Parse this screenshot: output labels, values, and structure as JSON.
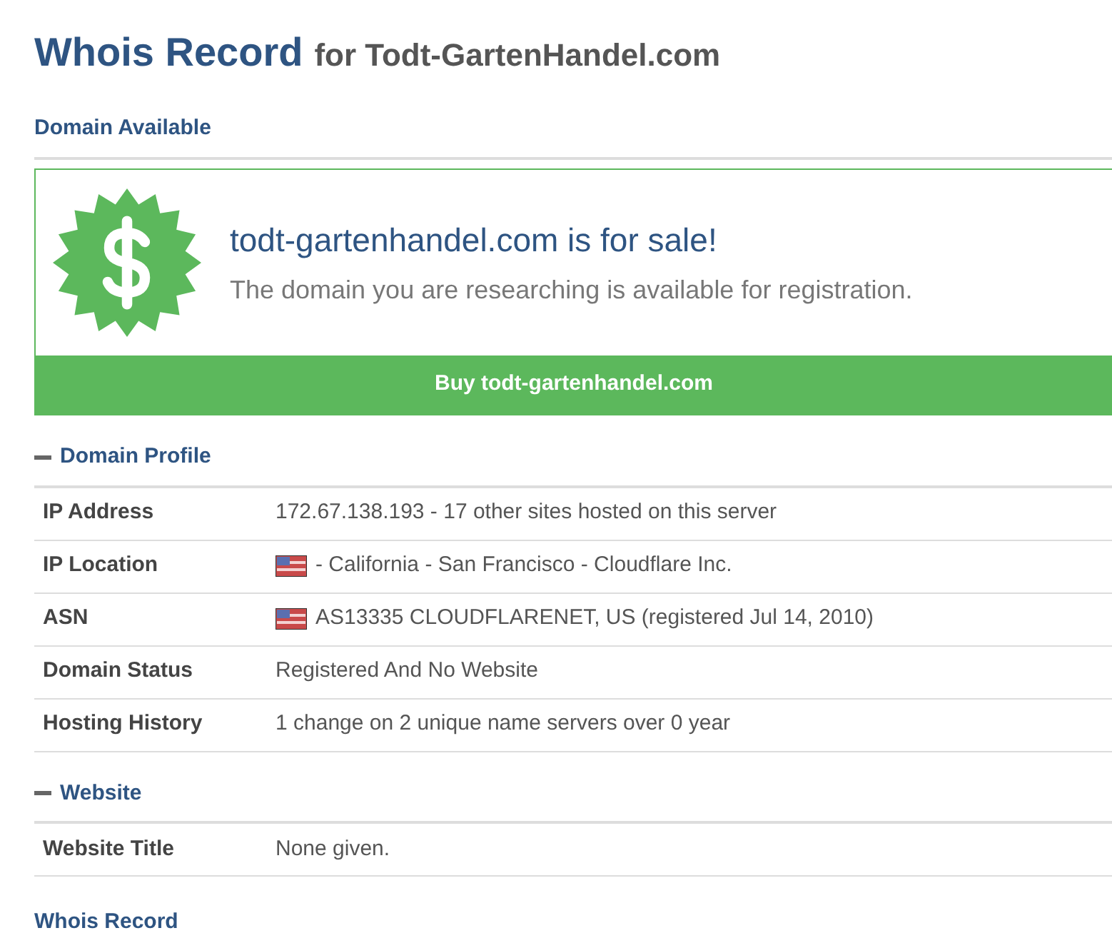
{
  "page_title": {
    "main": "Whois Record",
    "sub": "for Todt-GartenHandel.com"
  },
  "availability": {
    "heading": "Domain Available",
    "headline": "todt-gartenhandel.com is for sale!",
    "message": "The domain you are researching is available for registration.",
    "button": "Buy todt-gartenhandel.com"
  },
  "sections": [
    {
      "title": "Domain Profile",
      "expanded": true,
      "rows": [
        {
          "label": "IP Address",
          "value": "172.67.138.193 - 17 other sites hosted on this server",
          "flag": false
        },
        {
          "label": "IP Location",
          "value": "- California - San Francisco - Cloudflare Inc.",
          "flag": true
        },
        {
          "label": "ASN",
          "value": "AS13335 CLOUDFLARENET, US (registered Jul 14, 2010)",
          "flag": true
        },
        {
          "label": "Domain Status",
          "value": "Registered And No Website",
          "flag": false
        },
        {
          "label": "Hosting History",
          "value": "1 change on 2 unique name servers over 0 year",
          "flag": false
        }
      ]
    },
    {
      "title": "Website",
      "expanded": true,
      "rows": [
        {
          "label": "Website Title",
          "value": "None given.",
          "flag": false
        }
      ]
    }
  ],
  "footer_heading": "Whois Record"
}
